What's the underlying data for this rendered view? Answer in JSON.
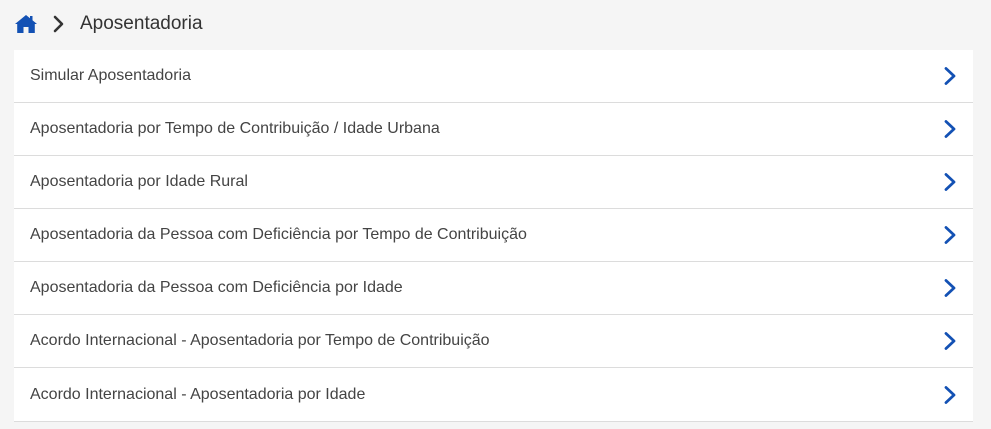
{
  "breadcrumb": {
    "home_icon": "home-icon",
    "separator_icon": "chevron-right-icon",
    "current": "Aposentadoria"
  },
  "items": [
    {
      "label": "Simular Aposentadoria"
    },
    {
      "label": "Aposentadoria por Tempo de Contribuição / Idade Urbana"
    },
    {
      "label": "Aposentadoria por Idade Rural"
    },
    {
      "label": "Aposentadoria da Pessoa com Deficiência por Tempo de Contribuição"
    },
    {
      "label": "Aposentadoria da Pessoa com Deficiência por Idade"
    },
    {
      "label": "Acordo Internacional - Aposentadoria por Tempo de Contribuição"
    },
    {
      "label": "Acordo Internacional - Aposentadoria por Idade"
    }
  ],
  "colors": {
    "accent": "#1351b4",
    "text": "#444444",
    "divider": "#dcdcdc",
    "background": "#f5f5f5"
  }
}
